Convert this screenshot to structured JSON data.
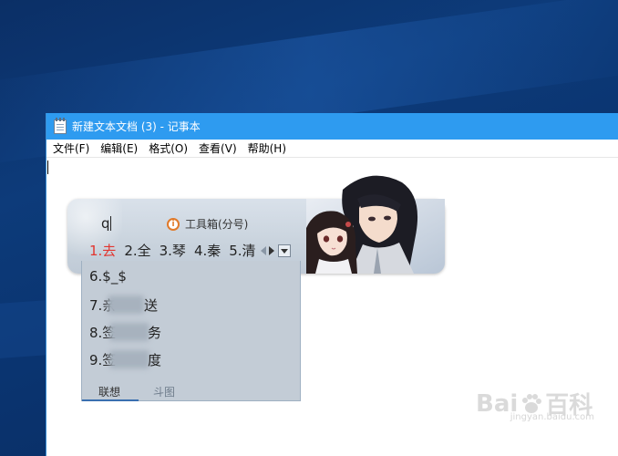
{
  "window": {
    "title": "新建文本文档 (3) - 记事本",
    "menu": [
      "文件(F)",
      "编辑(E)",
      "格式(O)",
      "查看(V)",
      "帮助(H)"
    ]
  },
  "ime": {
    "input": "q",
    "hint": "工具箱(分号)",
    "candidates": [
      "1.去",
      "2.全",
      "3.琴",
      "4.秦",
      "5.清"
    ],
    "dropdown_items": [
      "6.$_$",
      "7.亲",
      "送",
      "8.签",
      "务",
      "9.签",
      "度"
    ],
    "tabs": [
      "联想",
      "斗图"
    ]
  },
  "watermark": {
    "text_left": "Bai",
    "text_right": "百科",
    "sub": "jingyan.baidu.com"
  },
  "colors": {
    "titlebar": "#2e9bf0",
    "active_candidate": "#e2352f",
    "desktop": "#0d3b7a"
  }
}
